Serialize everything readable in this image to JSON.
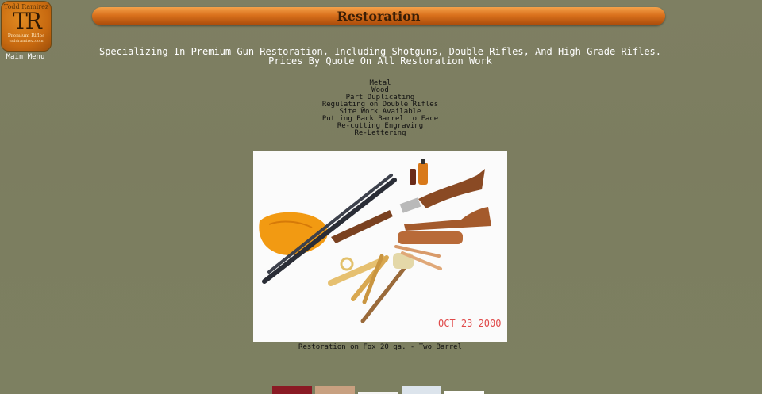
{
  "logo": {
    "name": "Todd Ramirez",
    "monogram": "TR",
    "subtitle": "Premium Rifles",
    "site": "toddramirez.com"
  },
  "nav": {
    "main_menu": "Main Menu"
  },
  "header": {
    "title": "Restoration"
  },
  "intro": "Specializing In Premium Gun Restoration, Including Shotguns, Double Rifles, And High Grade Rifles. Prices By Quote On All Restoration Work",
  "services": [
    "Metal",
    "Wood",
    "Part Duplicating",
    "Regulating on Double Rifles",
    "Site Work Available",
    "Putting Back Barrel to Face",
    "Re-cutting Engraving",
    "Re-Lettering"
  ],
  "photo": {
    "date_stamp": "OCT 23 2000",
    "caption": "Restoration on Fox 20 ga. - Two Barrel"
  },
  "thumbnails": [
    "red-thumb",
    "wood-thumb",
    "white-thumb",
    "gun-thumb",
    "white-thumb-2"
  ]
}
